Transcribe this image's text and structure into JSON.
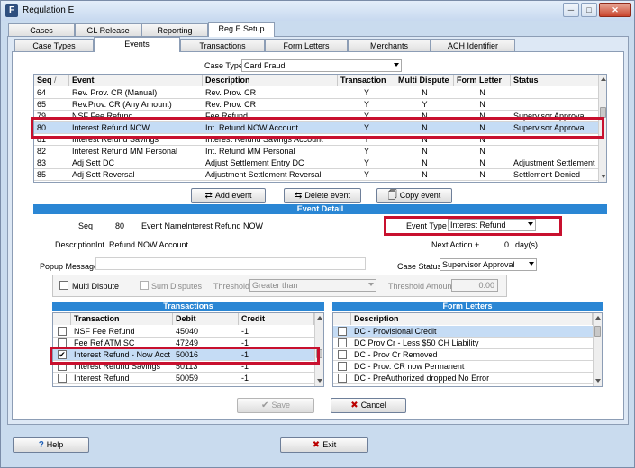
{
  "window": {
    "title": "Regulation E",
    "app_icon": "F"
  },
  "main_tabs": [
    "Cases",
    "GL Release",
    "Reporting",
    "Reg E Setup"
  ],
  "sub_tabs": [
    "Case Types",
    "Events",
    "Transactions",
    "Form Letters",
    "Merchants",
    "ACH Identifier"
  ],
  "case_type": {
    "label": "Case Type",
    "value": "Card Fraud"
  },
  "events_grid": {
    "headers": [
      "Seq",
      "/",
      "Event",
      "Description",
      "Transaction",
      "Multi Dispute",
      "Form Letter",
      "Status"
    ],
    "rows": [
      {
        "seq": "64",
        "event": "Rev. Prov. CR (Manual)",
        "description": "Rev. Prov. CR",
        "transaction": "Y",
        "multi_dispute": "N",
        "form_letter": "N",
        "status": ""
      },
      {
        "seq": "65",
        "event": "Rev.Prov. CR (Any Amount)",
        "description": "Rev. Prov. CR",
        "transaction": "Y",
        "multi_dispute": "Y",
        "form_letter": "N",
        "status": ""
      },
      {
        "seq": "79",
        "event": "NSF Fee Refund",
        "description": "Fee Refund",
        "transaction": "Y",
        "multi_dispute": "N",
        "form_letter": "N",
        "status": "Supervisor Approval"
      },
      {
        "seq": "80",
        "event": "Interest Refund NOW",
        "description": "Int. Refund NOW Account",
        "transaction": "Y",
        "multi_dispute": "N",
        "form_letter": "N",
        "status": "Supervisor Approval"
      },
      {
        "seq": "81",
        "event": "Interest Refund Savings",
        "description": "Interest Refund Savings Account",
        "transaction": "Y",
        "multi_dispute": "N",
        "form_letter": "N",
        "status": ""
      },
      {
        "seq": "82",
        "event": "Interest Refund MM Personal",
        "description": "Int. Refund MM Personal",
        "transaction": "Y",
        "multi_dispute": "N",
        "form_letter": "N",
        "status": ""
      },
      {
        "seq": "83",
        "event": "Adj Sett DC",
        "description": "Adjust Settlement Entry DC",
        "transaction": "Y",
        "multi_dispute": "N",
        "form_letter": "N",
        "status": "Adjustment Settlement"
      },
      {
        "seq": "85",
        "event": "Adj Sett Reversal",
        "description": "Adjustment Settlement Reversal",
        "transaction": "Y",
        "multi_dispute": "N",
        "form_letter": "N",
        "status": "Settlement Denied"
      }
    ],
    "selected_index": 3
  },
  "event_buttons": {
    "add": "Add event",
    "delete": "Delete event",
    "copy": "Copy event"
  },
  "event_detail": {
    "section_title": "Event Detail",
    "seq_label": "Seq",
    "seq_value": "80",
    "event_name_label": "Event Name",
    "event_name_value": "Interest Refund NOW",
    "event_type_label": "Event Type",
    "event_type_value": "Interest Refund",
    "description_label": "Description",
    "description_value": "Int. Refund NOW Account",
    "next_action_label": "Next Action +",
    "next_action_value": "0",
    "next_action_unit": "day(s)",
    "popup_label": "Popup Message",
    "popup_value": "",
    "case_status_label": "Case Status",
    "case_status_value": "Supervisor Approval",
    "multi_dispute_label": "Multi Dispute",
    "sum_disputes_label": "Sum Disputes",
    "threshold_label": "Threshold",
    "threshold_value": "Greater than",
    "threshold_amount_label": "Threshold Amount",
    "threshold_amount_value": "0.00"
  },
  "transactions": {
    "section_title": "Transactions",
    "headers": [
      "Transaction",
      "Debit",
      "Credit"
    ],
    "rows": [
      {
        "checked": false,
        "transaction": "NSF Fee Refund",
        "debit": "45040",
        "credit": "-1"
      },
      {
        "checked": false,
        "transaction": "Fee Ref ATM SC",
        "debit": "47249",
        "credit": "-1"
      },
      {
        "checked": true,
        "transaction": "Interest Refund - Now Acct",
        "debit": "50016",
        "credit": "-1"
      },
      {
        "checked": false,
        "transaction": "Interest Refund Savings",
        "debit": "50113",
        "credit": "-1"
      },
      {
        "checked": false,
        "transaction": "Interest Refund",
        "debit": "50059",
        "credit": "-1"
      }
    ]
  },
  "form_letters": {
    "section_title": "Form Letters",
    "headers": [
      "Description"
    ],
    "rows": [
      {
        "checked": false,
        "description": "DC - Provisional Credit"
      },
      {
        "checked": false,
        "description": "DC Prov Cr - Less $50 CH Liability"
      },
      {
        "checked": false,
        "description": "DC - Prov Cr Removed"
      },
      {
        "checked": false,
        "description": "DC - Prov. CR now Permanent"
      },
      {
        "checked": false,
        "description": "DC - PreAuthorized dropped No Error"
      }
    ]
  },
  "save_button": "Save",
  "cancel_button": "Cancel",
  "help_button": "Help",
  "exit_button": "Exit"
}
